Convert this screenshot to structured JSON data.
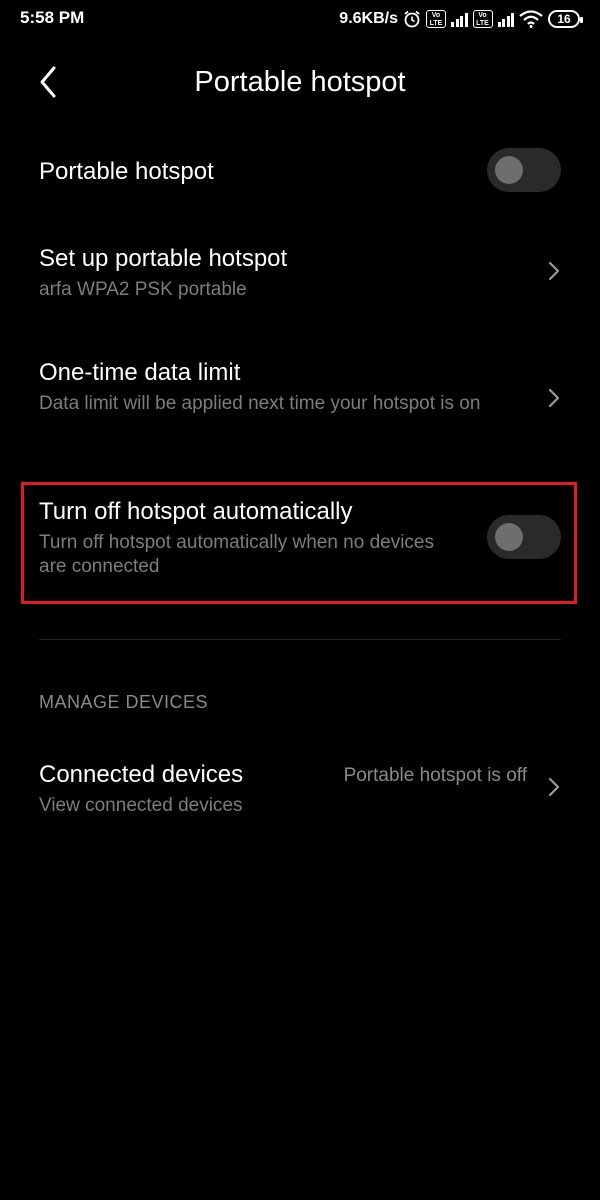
{
  "status_bar": {
    "time": "5:58 PM",
    "speed": "9.6KB/s",
    "volte_label": "Vo LTE",
    "battery": "16"
  },
  "header": {
    "title": "Portable hotspot"
  },
  "settings": {
    "portable_hotspot": {
      "title": "Portable hotspot",
      "enabled": false
    },
    "setup": {
      "title": "Set up portable hotspot",
      "subtitle": "arfa WPA2 PSK portable"
    },
    "data_limit": {
      "title": "One-time data limit",
      "subtitle": "Data limit will be applied next time your hotspot is on"
    },
    "auto_off": {
      "title": "Turn off hotspot automatically",
      "subtitle": "Turn off hotspot automatically when no devices are connected",
      "enabled": false
    }
  },
  "manage_devices": {
    "header": "MANAGE DEVICES",
    "connected": {
      "title": "Connected devices",
      "subtitle": "View connected devices",
      "value": "Portable hotspot is off"
    }
  },
  "colors": {
    "background": "#000000",
    "highlight": "#e01b24",
    "secondary_text": "#7d7d7d"
  }
}
